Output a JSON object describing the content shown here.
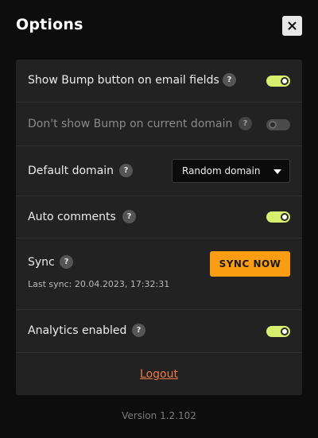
{
  "header": {
    "title": "Options",
    "close_icon": "close-icon"
  },
  "settings": {
    "show_bump_button": {
      "label": "Show Bump button on email fields",
      "help": "?",
      "enabled": true
    },
    "dont_show_on_domain": {
      "label": "Don't show Bump on current domain",
      "help": "?",
      "enabled": false,
      "disabled": true
    },
    "default_domain": {
      "label": "Default domain",
      "help": "?",
      "selected": "Random domain"
    },
    "auto_comments": {
      "label": "Auto comments",
      "help": "?",
      "enabled": true
    },
    "sync": {
      "label": "Sync",
      "help": "?",
      "button_label": "SYNC NOW",
      "last_sync": "Last sync: 20.04.2023, 17:32:31"
    },
    "analytics": {
      "label": "Analytics enabled",
      "help": "?",
      "enabled": true
    }
  },
  "footer": {
    "logout_label": "Logout",
    "version": "Version 1.2.102"
  },
  "colors": {
    "toggle_on": "#d7ee6e",
    "toggle_off": "#4b4b4b",
    "sync_button": "#fa9d12",
    "logout_link": "#f07a43",
    "panel": "#222222",
    "background": "#0d0d0d"
  }
}
